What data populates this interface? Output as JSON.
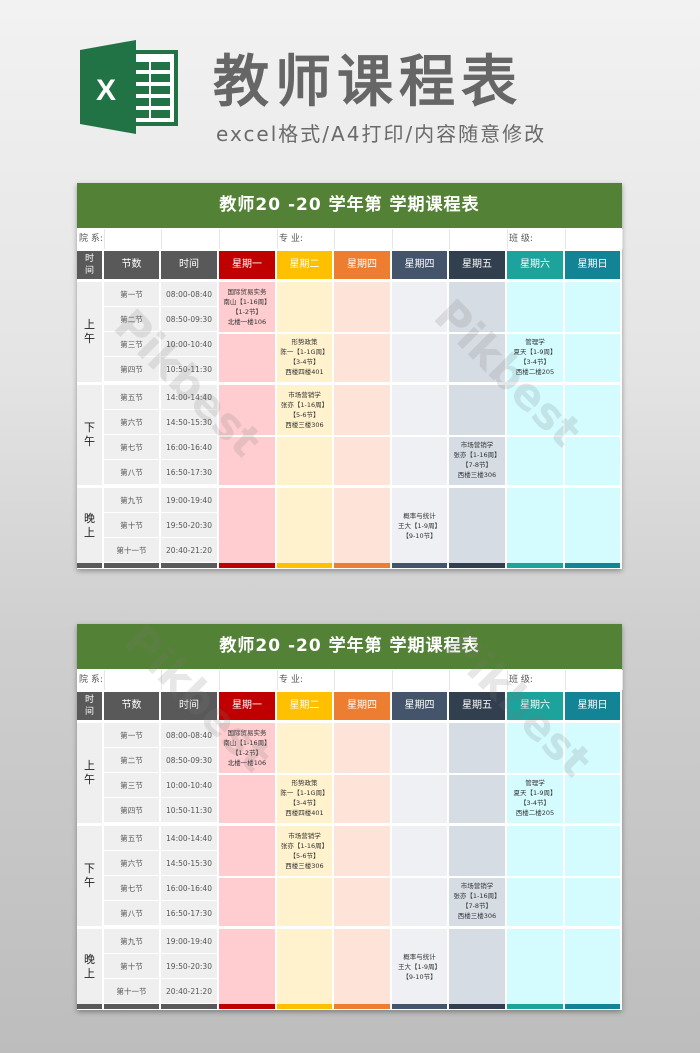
{
  "banner": {
    "title": "教师课程表",
    "subtitle": "excel格式/A4打印/内容随意修改",
    "logo_icon": "excel-icon",
    "logo_letter": "X"
  },
  "colors": {
    "title_bar": "#538135",
    "headers": [
      "#595959",
      "#595959",
      "#595959",
      "#c00000",
      "#ffc000",
      "#ed7d31",
      "#44546a",
      "#323f4f",
      "#1ba39c",
      "#138496"
    ],
    "fills": [
      "#ffcdd0",
      "#fff2cc",
      "#fde3d8",
      "#eef0f3",
      "#d6dce4",
      "#d4fcff",
      "#d4fcff"
    ]
  },
  "sheets": [
    {
      "title": "教师20    -20    学年第    学期课程表",
      "info": {
        "department": "院 系:",
        "major": "专 业:",
        "class": "班 级:"
      },
      "headers": [
        "时间",
        "节数",
        "时间",
        "星期一",
        "星期二",
        "星期四",
        "星期四",
        "星期五",
        "星期六",
        "星期日"
      ],
      "segments": [
        {
          "label": "上午",
          "periods": [
            {
              "name": "第一节",
              "time": "08:00-08:40"
            },
            {
              "name": "第二节",
              "time": "08:50-09:30"
            },
            {
              "name": "第三节",
              "time": "10:00-10:40"
            },
            {
              "name": "第四节",
              "time": "10:50-11:30"
            }
          ]
        },
        {
          "label": "下午",
          "periods": [
            {
              "name": "第五节",
              "time": "14:00-14:40"
            },
            {
              "name": "第六节",
              "time": "14:50-15:30"
            },
            {
              "name": "第七节",
              "time": "16:00-16:40"
            },
            {
              "name": "第八节",
              "time": "16:50-17:30"
            }
          ]
        },
        {
          "label": "晚上",
          "periods": [
            {
              "name": "第九节",
              "time": "19:00-19:40"
            },
            {
              "name": "第十节",
              "time": "19:50-20:30"
            },
            {
              "name": "第十一节",
              "time": "20:40-21:20"
            }
          ]
        }
      ],
      "courses": [
        {
          "day": "星期一",
          "lines": [
            "国际贸易实务",
            "南山【1-16周】",
            "【1-2节】",
            "北楼一楼106"
          ]
        },
        {
          "day": "星期二",
          "lines": [
            "形势政策",
            "陈一【1-1G周】",
            "【3-4节】",
            "西楼四楼401"
          ]
        },
        {
          "day": "星期六",
          "lines": [
            "管理学",
            "夏天【1-9周】",
            "【3-4节】",
            "西楼二楼205"
          ]
        },
        {
          "day": "星期二",
          "lines": [
            "市场营销学",
            "张亦【1-16周】",
            "【5-6节】",
            "西楼三楼306"
          ]
        },
        {
          "day": "星期五",
          "lines": [
            "市场营销学",
            "张亦【1-16周】",
            "【7-8节】",
            "西楼三楼306"
          ]
        },
        {
          "day": "星期四",
          "lines": [
            "概率与统计",
            "王大【1-9周】",
            "【9-10节】"
          ]
        }
      ]
    },
    {
      "title": "教师20    -20    学年第    学期课程表",
      "info": {
        "department": "院 系:",
        "major": "专 业:",
        "class": "班 级:"
      },
      "headers": [
        "时间",
        "节数",
        "时间",
        "星期一",
        "星期二",
        "星期四",
        "星期四",
        "星期五",
        "星期六",
        "星期日"
      ],
      "segments": [
        {
          "label": "上午",
          "periods": [
            {
              "name": "第一节",
              "time": "08:00-08:40"
            },
            {
              "name": "第二节",
              "time": "08:50-09:30"
            },
            {
              "name": "第三节",
              "time": "10:00-10:40"
            },
            {
              "name": "第四节",
              "time": "10:50-11:30"
            }
          ]
        },
        {
          "label": "下午",
          "periods": [
            {
              "name": "第五节",
              "time": "14:00-14:40"
            },
            {
              "name": "第六节",
              "time": "14:50-15:30"
            },
            {
              "name": "第七节",
              "time": "16:00-16:40"
            },
            {
              "name": "第八节",
              "time": "16:50-17:30"
            }
          ]
        },
        {
          "label": "晚上",
          "periods": [
            {
              "name": "第九节",
              "time": "19:00-19:40"
            },
            {
              "name": "第十节",
              "time": "19:50-20:30"
            },
            {
              "name": "第十一节",
              "time": "20:40-21:20"
            }
          ]
        }
      ],
      "courses": [
        {
          "day": "星期一",
          "lines": [
            "国际贸易实务",
            "南山【1-16周】",
            "【1-2节】",
            "北楼一楼106"
          ]
        },
        {
          "day": "星期二",
          "lines": [
            "形势政策",
            "陈一【1-1G周】",
            "【3-4节】",
            "西楼四楼401"
          ]
        },
        {
          "day": "星期六",
          "lines": [
            "管理学",
            "夏天【1-9周】",
            "【3-4节】",
            "西楼二楼205"
          ]
        },
        {
          "day": "星期二",
          "lines": [
            "市场营销学",
            "张亦【1-16周】",
            "【5-6节】",
            "西楼三楼306"
          ]
        },
        {
          "day": "星期五",
          "lines": [
            "市场营销学",
            "张亦【1-16周】",
            "【7-8节】",
            "西楼三楼306"
          ]
        },
        {
          "day": "星期四",
          "lines": [
            "概率与统计",
            "王大【1-9周】",
            "【9-10节】"
          ]
        }
      ]
    }
  ],
  "watermark": "Pikbest"
}
